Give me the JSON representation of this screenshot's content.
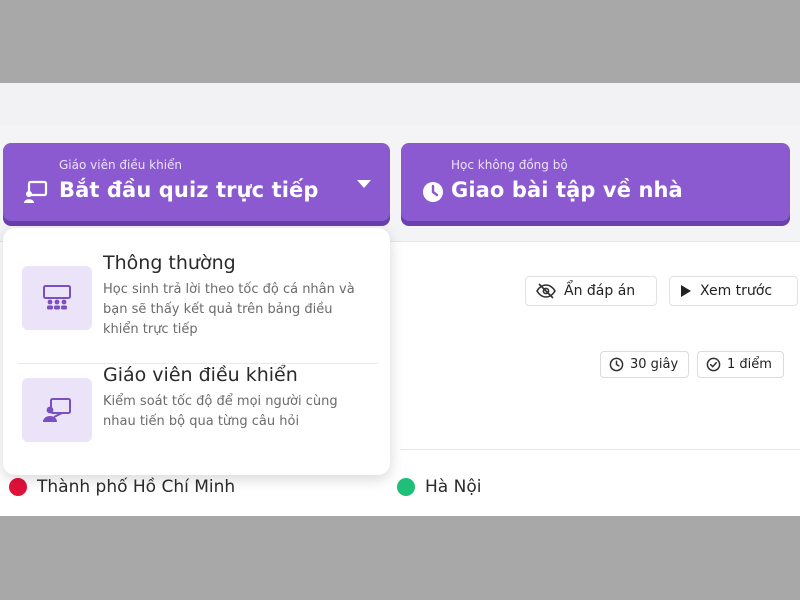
{
  "mode_buttons": {
    "teacher_paced": {
      "subtitle": "Giáo viên điều khiển",
      "title": "Bắt đầu quiz trực tiếp",
      "icon": "presentation-board-icon"
    },
    "async": {
      "subtitle": "Học không đồng bộ",
      "title": "Giao bài tập về nhà",
      "icon": "clock-icon"
    }
  },
  "dropdown": {
    "options": [
      {
        "title": "Thông thường",
        "description": "Học sinh trả lời theo tốc độ cá nhân và bạn sẽ thấy kết quả trên bảng điều khiển trực tiếp",
        "icon": "classroom-group-icon"
      },
      {
        "title": "Giáo viên điều khiển",
        "description": "Kiểm soát tốc độ để mọi người cùng nhau tiến bộ qua từng câu hỏi",
        "icon": "teacher-presenting-icon"
      }
    ]
  },
  "toolbar": {
    "hide_answers": "Ẩn đáp án",
    "preview": "Xem trước"
  },
  "question_meta": {
    "time": "30 giây",
    "points": "1 điểm"
  },
  "answers": [
    {
      "text": "Thành phố Hồ Chí Minh",
      "color": "#e0123a"
    },
    {
      "text": "Hà Nội",
      "color": "#1fbf7a"
    }
  ],
  "colors": {
    "accent": "#8b59d0",
    "accent_shadow": "#6a3fae",
    "tile": "#ebe3f8"
  }
}
